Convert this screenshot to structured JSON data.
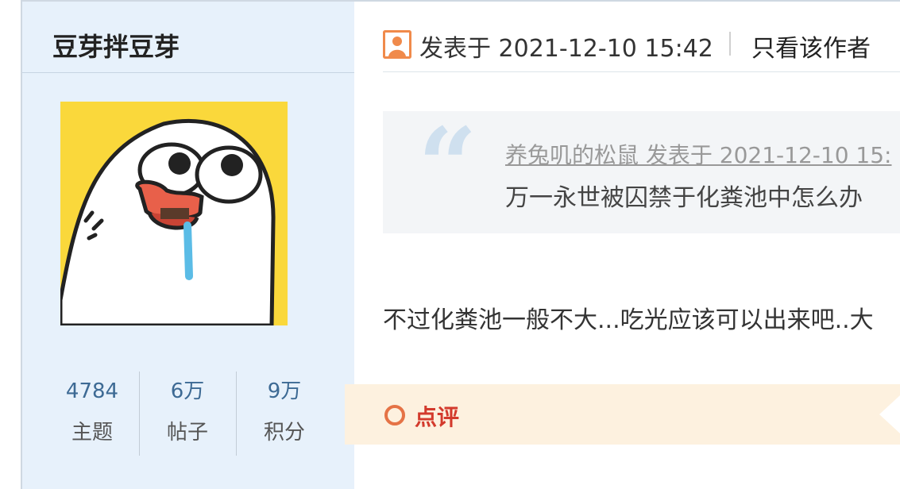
{
  "author": {
    "name": "豆芽拌豆芽",
    "stats": [
      {
        "value": "4784",
        "label": "主题"
      },
      {
        "value": "6万",
        "label": "帖子"
      },
      {
        "value": "9万",
        "label": "积分"
      }
    ]
  },
  "post": {
    "meta": "发表于 2021-12-10 15:42",
    "only_author": "只看该作者",
    "quote": {
      "source": "养兔叽的松鼠 发表于 2021-12-10 15:",
      "text": "万一永世被囚禁于化粪池中怎么办"
    },
    "body": "不过化粪池一般不大...吃光应该可以出来吧..大"
  },
  "comment": {
    "label": "点评"
  },
  "colors": {
    "accent_blue": "#3d6a94",
    "comment_red": "#d33a2c",
    "sidebar_bg": "#e7f1fb"
  }
}
